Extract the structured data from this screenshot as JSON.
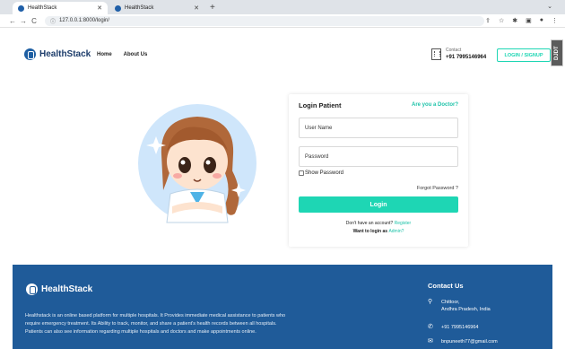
{
  "browser": {
    "tabs": [
      {
        "title": "HealthStack",
        "active": true
      },
      {
        "title": "HealthStack",
        "active": false
      }
    ],
    "new_tab": "+",
    "url": "127.0.0.1:8000/login/",
    "nav": {
      "back": "←",
      "forward": "→",
      "reload": "C"
    }
  },
  "header": {
    "brand": "HealthStack",
    "nav": [
      "Home",
      "About Us"
    ],
    "contact_label": "Contact",
    "contact_phone": "+91 7995146964",
    "login_signup": "LOGIN / SIGNUP",
    "extension_badge": "DJDT"
  },
  "login": {
    "title": "Login Patient",
    "doctor_link": "Are you a Doctor?",
    "username_placeholder": "User Name",
    "password_placeholder": "Password",
    "show_password": "Show Password",
    "forgot": "Forgot Password ?",
    "button": "Login",
    "no_account": "Don't have an account?",
    "register": "Register",
    "want_admin": "Want to login as",
    "admin": "Admin?"
  },
  "footer": {
    "brand": "HealthStack",
    "description": "Healthstack is an online based platform for multiple hospitals. It Provides immediate medical assistance to patients who require emergency treatment. Its Ability to track, monitor, and share a patient's health records between all hospitals. Patients can also see information regarding multiple hospitals and doctors and make appointments online.",
    "contact_title": "Contact Us",
    "address_line1": "Chittoor,",
    "address_line2": "Andhra Pradesh, India",
    "phone": "+91 7995146964",
    "email": "bnpuneeth77@gmail.com"
  },
  "colors": {
    "accent": "#1ed6b4",
    "brand_blue": "#1d3d6b",
    "footer_bg": "#1f5b99"
  }
}
